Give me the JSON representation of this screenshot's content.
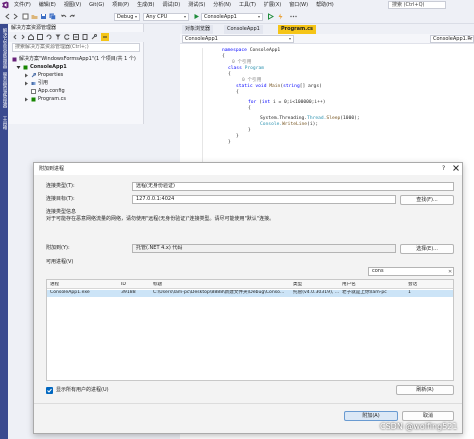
{
  "menubar": {
    "items": [
      "文件(F)",
      "编辑(E)",
      "视图(V)",
      "Git(G)",
      "项目(P)",
      "生成(B)",
      "调试(D)",
      "测试(S)",
      "分析(N)",
      "工具(T)",
      "扩展(X)",
      "窗口(W)",
      "帮助(H)"
    ],
    "search_placeholder": "搜索 (Ctrl+Q)"
  },
  "toolbar": {
    "config": "Debug",
    "platform": "Any CPU",
    "startup": "ConsoleApp1"
  },
  "left_strip": {
    "tabs": [
      "解决方案资源管理器",
      "服务器资源管理器",
      "工具箱"
    ]
  },
  "solution_explorer": {
    "title": "解决方案资源管理器",
    "search_placeholder": "搜索解决方案资源管理器(Ctrl+;)",
    "tree": [
      {
        "label": "解决方案\"WindowsFormsApp1\"(1 个项目/共 1 个)",
        "icon": "solution-icon"
      },
      {
        "label": "ConsoleApp1",
        "icon": "csharp-project-icon"
      },
      {
        "label": "Properties",
        "icon": "properties-icon"
      },
      {
        "label": "引用",
        "icon": "references-icon"
      },
      {
        "label": "App.config",
        "icon": "config-file-icon"
      },
      {
        "label": "Program.cs",
        "icon": "csharp-file-icon"
      }
    ]
  },
  "editor": {
    "tabs": [
      "对象浏览器",
      "ConsoleApp1",
      "Program.cs"
    ],
    "nav_left": "ConsoleApp1",
    "nav_right": "ConsoleApp1.Pr"
  },
  "code": {
    "ns_kw": "namespace",
    "ns_name": "ConsoleApp1",
    "ref1": "0 个引用",
    "class_kw": "class",
    "class_name": "Program",
    "ref2": "0 个引用",
    "main_static": "static",
    "main_void": "void",
    "main_name": "Main",
    "main_string": "string",
    "main_args": "[] args)",
    "for_kw": "for",
    "for_int": "int",
    "for_rest": " i = 0;i<100000;i++)",
    "sleep_sys": "System.",
    "sleep_thr": "Threading.",
    "sleep_type": "Thread.",
    "sleep_mt": "Sleep",
    "sleep_arg": "(1000);",
    "write_type": "Console.",
    "write_mt": "WriteLine",
    "write_arg": "(i);"
  },
  "dialog": {
    "title": "附加到进程",
    "conn_type_label": "连接类型(T):",
    "conn_type_value": "远程(无身份验证)",
    "conn_target_label": "连接目标(T):",
    "conn_target_value": "127.0.0.1:4024",
    "find_button": "查找(F)...",
    "conn_info_label": "连接类型信息",
    "conn_info_text": "对于可能存在恶意网络流量的网络，请勿使用\"远程(无身份验证)\"连接类型。请尽可能使用\"默认\"连接。",
    "attach_to_label": "附加到(Y):",
    "attach_to_value": "托管(.NET 4.x) 代码",
    "select_button": "选择(E)...",
    "processes_label": "可用进程(V)",
    "filter_value": "cons",
    "columns": [
      "进程",
      "ID",
      "标题",
      "类型",
      "用户名",
      "会话"
    ],
    "rows": [
      [
        "ConsoleApp1.exe",
        "39188",
        "C:\\Users\\lam-pc\\Desktop\\8888\\新建文件夹\\Debug\\Conso...",
        "托管(v4.0.30319), ...",
        "老子就是上你\\lam-pc",
        "1"
      ]
    ],
    "show_all_users": "显示所有用户的进程(U)",
    "refresh_button": "刷新(R)",
    "attach_button": "附加(A)",
    "cancel_button": "取消"
  },
  "watermark": "CSDN @wolfing521"
}
